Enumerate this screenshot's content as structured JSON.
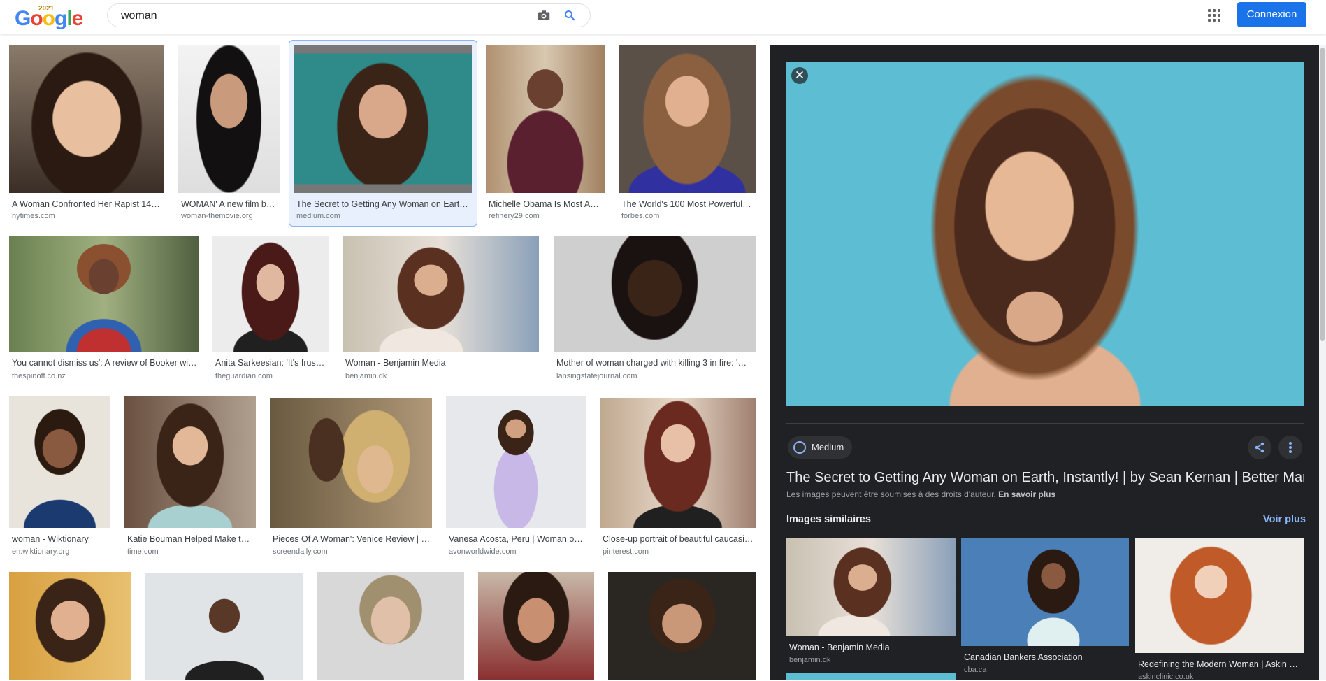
{
  "header": {
    "logo_text": "Google",
    "logo_year": "2021",
    "search_value": "woman",
    "camera_icon": "camera-icon",
    "search_icon": "search-icon",
    "apps_icon": "apps-grid-icon",
    "login_label": "Connexion"
  },
  "results": [
    {
      "caption": "A Woman Confronted Her Rapist 14 …",
      "source": "nytimes.com"
    },
    {
      "caption": "WOMAN' A new film by…",
      "source": "woman-themovie.org"
    },
    {
      "caption": "The Secret to Getting Any Woman on Earth,…",
      "source": "medium.com"
    },
    {
      "caption": "Michelle Obama Is Most Ad…",
      "source": "refinery29.com"
    },
    {
      "caption": "The World's 100 Most Powerful …",
      "source": "forbes.com"
    },
    {
      "caption": "You cannot dismiss us': A review of Booker wi…",
      "source": "thespinoff.co.nz"
    },
    {
      "caption": "Anita Sarkeesian: 'It's frust…",
      "source": "theguardian.com"
    },
    {
      "caption": "Woman - Benjamin Media",
      "source": "benjamin.dk"
    },
    {
      "caption": "Mother of woman charged with killing 3 in fire: 'S…",
      "source": "lansingstatejournal.com"
    },
    {
      "caption": "woman - Wiktionary",
      "source": "en.wiktionary.org"
    },
    {
      "caption": "Katie Bouman Helped Make th…",
      "source": "time.com"
    },
    {
      "caption": "Pieces Of A Woman': Venice Review | R…",
      "source": "screendaily.com"
    },
    {
      "caption": "Vanesa Acosta, Peru | Woman of …",
      "source": "avonworldwide.com"
    },
    {
      "caption": "Close-up portrait of beautiful caucasi…",
      "source": "pinterest.com"
    },
    {
      "caption": "",
      "source": ""
    },
    {
      "caption": "",
      "source": ""
    },
    {
      "caption": "",
      "source": ""
    },
    {
      "caption": "",
      "source": ""
    },
    {
      "caption": "",
      "source": ""
    }
  ],
  "panel": {
    "close_icon": "close-icon",
    "site_chip": "Medium",
    "share_icon": "share-icon",
    "more_icon": "more-vert-icon",
    "title": "The Secret to Getting Any Woman on Earth, Instantly! | by Sean Kernan | Better Mark",
    "copyright_text": "Les images peuvent être soumises à des droits d'auteur.",
    "copyright_link": "En savoir plus",
    "similar_heading": "Images similaires",
    "see_more": "Voir plus",
    "similar": [
      {
        "caption": "Woman - Benjamin Media",
        "source": "benjamin.dk"
      },
      {
        "caption": "Canadian Bankers Association",
        "source": "cba.ca"
      },
      {
        "caption": "Redefining the Modern Woman | Askin Cl…",
        "source": "askinclinic.co.uk"
      }
    ]
  },
  "colors": {
    "accent": "#1a73e8",
    "panel_bg": "#202124",
    "link_dark": "#8ab4f8"
  }
}
